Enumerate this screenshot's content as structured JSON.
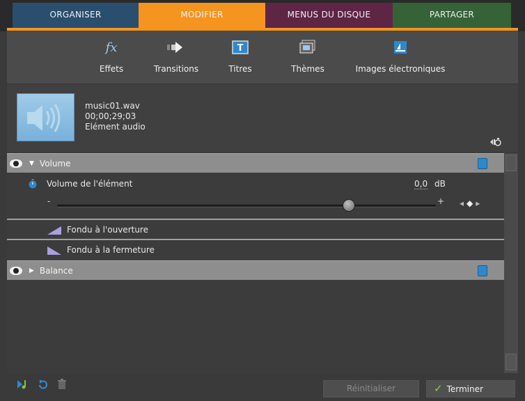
{
  "tabs": [
    {
      "label": "ORGANISER"
    },
    {
      "label": "MODIFIER"
    },
    {
      "label": "MENUS DU DISQUE"
    },
    {
      "label": "PARTAGER"
    }
  ],
  "tools": [
    {
      "label": "Effets",
      "icon": "fx-icon"
    },
    {
      "label": "Transitions",
      "icon": "arrow-right-icon"
    },
    {
      "label": "Titres",
      "icon": "titles-icon"
    },
    {
      "label": "Thèmes",
      "icon": "themes-icon"
    },
    {
      "label": "Images électroniques",
      "icon": "clipart-icon"
    }
  ],
  "clip": {
    "filename": "music01.wav",
    "timecode": "00;00;29;03",
    "type": "Elément audio"
  },
  "volume_section": {
    "title": "Volume",
    "clip_volume_label": "Volume de l'élément",
    "clip_volume_value": "0,0",
    "clip_volume_unit": "dB",
    "slider_min_label": "-",
    "slider_max_label": "+",
    "slider_level": 0.77,
    "fade_in_label": "Fondu à l'ouverture",
    "fade_out_label": "Fondu à la fermeture"
  },
  "balance_section": {
    "title": "Balance"
  },
  "buttons": {
    "reset_label": "Réinitialiser",
    "done_label": "Terminer"
  },
  "colors": {
    "organiser": "#2a4e6e",
    "modifier": "#f5941e",
    "menus": "#5f2545",
    "partager": "#356237",
    "accent_blue": "#2e88cc"
  }
}
